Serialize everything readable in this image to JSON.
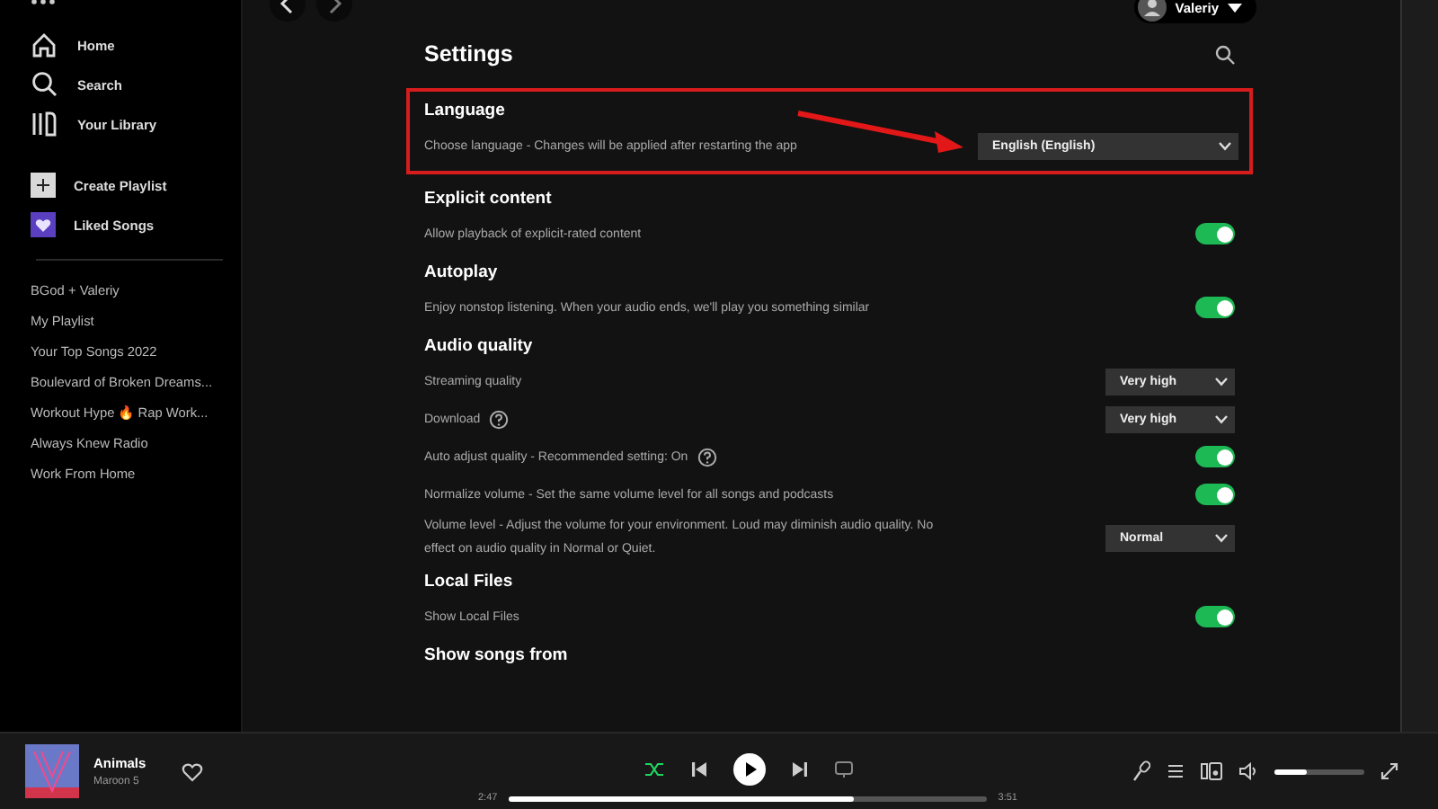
{
  "sidebar": {
    "nav": [
      {
        "kind": "home",
        "label": "Home",
        "selected": false
      },
      {
        "kind": "search",
        "label": "Search",
        "selected": false
      },
      {
        "kind": "library",
        "label": "Your Library",
        "selected": false
      }
    ],
    "actions": [
      {
        "kind": "create",
        "label": "Create Playlist"
      },
      {
        "kind": "liked",
        "label": "Liked Songs"
      }
    ],
    "playlists": [
      "BGod + Valeriy",
      "My Playlist",
      "Your Top Songs 2022",
      "Boulevard of Broken Dreams...",
      "Workout Hype 🔥 Rap Work...",
      "Always Knew Radio",
      "Work From Home"
    ]
  },
  "topbar": {
    "user": "Valeriy"
  },
  "settings": {
    "title": "Settings",
    "sections": [
      {
        "title": "Language",
        "highlighted": true,
        "rows": [
          {
            "kind": "select",
            "label": "Choose language - Changes will be applied after restarting the app",
            "value": "English (English)",
            "help": false
          }
        ]
      },
      {
        "title": "Explicit content",
        "highlighted": false,
        "rows": [
          {
            "kind": "toggle",
            "label": "Allow playback of explicit-rated content",
            "on": true,
            "help": false
          }
        ]
      },
      {
        "title": "Autoplay",
        "highlighted": false,
        "rows": [
          {
            "kind": "toggle",
            "label": "Enjoy nonstop listening. When your audio ends, we'll play you something similar",
            "on": true,
            "help": false
          }
        ]
      },
      {
        "title": "Audio quality",
        "highlighted": false,
        "rows": [
          {
            "kind": "select",
            "label": "Streaming quality",
            "value": "Very high",
            "help": false
          },
          {
            "kind": "select",
            "label": "Download",
            "value": "Very high",
            "help": true
          },
          {
            "kind": "toggle",
            "label": "Auto adjust quality - Recommended setting: On",
            "on": true,
            "help": true
          },
          {
            "kind": "toggle",
            "label": "Normalize volume - Set the same volume level for all songs and podcasts",
            "on": true,
            "help": false
          },
          {
            "kind": "select",
            "label": "Volume level - Adjust the volume for your environment. Loud may diminish audio quality. No effect on audio quality in Normal or Quiet.",
            "value": "Normal",
            "help": false
          }
        ]
      },
      {
        "title": "Local Files",
        "highlighted": false,
        "rows": [
          {
            "kind": "toggle",
            "label": "Show Local Files",
            "on": true,
            "help": false
          }
        ]
      },
      {
        "title": "Show songs from",
        "highlighted": false
      }
    ]
  },
  "player": {
    "track": "Animals",
    "artist": "Maroon 5",
    "liked": false,
    "shuffle": true,
    "elapsed": "2:47",
    "total": "3:51",
    "progress": {
      "level": 0.72
    },
    "volume": {
      "level": 0.35
    }
  }
}
